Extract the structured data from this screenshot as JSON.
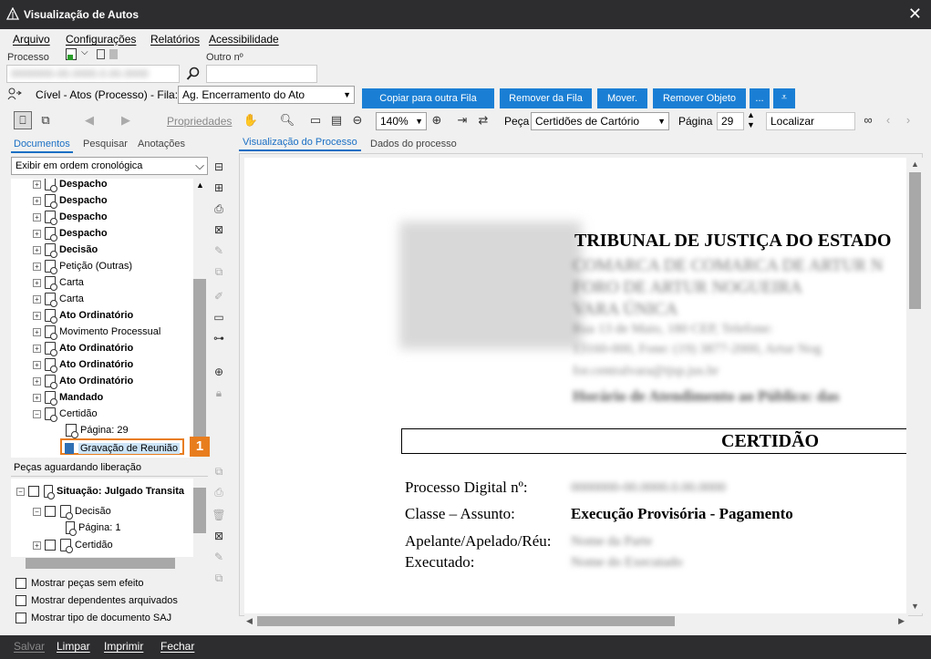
{
  "window": {
    "title": "Visualização de Autos",
    "close": "✕"
  },
  "menu": {
    "file": "Arquivo",
    "settings": "Configurações",
    "reports": "Relatórios",
    "accessibility": "Acessibilidade"
  },
  "process_bar": {
    "process_label": "Processo",
    "other_label": "Outro nº",
    "process_value": "0000000-00.0000.0.00.0000"
  },
  "queue_bar": {
    "queue_label": "Cível - Atos (Processo) - Fila:",
    "queue_value": "Ag. Encerramento do Ato",
    "copy_btn": "Copiar para outra Fila",
    "remove_btn": "Remover da Fila",
    "move_btn": "Mover.",
    "remove_obj_btn": "Remover Objeto",
    "more_btn": "..."
  },
  "toolbar": {
    "properties": "Propriedades",
    "zoom": "140%",
    "piece_label": "Peça",
    "piece_value": "Certidões de Cartório",
    "page_label": "Página",
    "page_value": "29",
    "find_placeholder": "Localizar"
  },
  "left_tabs": {
    "documents": "Documentos",
    "search": "Pesquisar",
    "notes": "Anotações"
  },
  "order_select": "Exibir em ordem cronológica",
  "tree": [
    {
      "label": "Despacho",
      "bold": true
    },
    {
      "label": "Despacho",
      "bold": true
    },
    {
      "label": "Despacho",
      "bold": true
    },
    {
      "label": "Despacho",
      "bold": true
    },
    {
      "label": "Decisão",
      "bold": true
    },
    {
      "label": "Petição (Outras)",
      "bold": false
    },
    {
      "label": "Carta",
      "bold": false
    },
    {
      "label": "Carta",
      "bold": false
    },
    {
      "label": "Ato Ordinatório",
      "bold": true
    },
    {
      "label": "Movimento Processual",
      "bold": false
    },
    {
      "label": "Ato Ordinatório",
      "bold": true
    },
    {
      "label": "Ato Ordinatório",
      "bold": true
    },
    {
      "label": "Ato Ordinatório",
      "bold": true
    },
    {
      "label": "Mandado",
      "bold": true
    },
    {
      "label": "Certidão",
      "bold": false
    }
  ],
  "tree_child_page": "Página: 29",
  "tree_selected": "Gravação de Reunião",
  "callout": "1",
  "pending": {
    "title": "Peças aguardando liberação",
    "situation": "Situação: Julgado Transita",
    "decision": "Decisão",
    "page": "Página: 1",
    "certidao": "Certidão"
  },
  "checks": {
    "no_effect": "Mostrar peças sem efeito",
    "archived": "Mostrar dependentes arquivados",
    "doc_type": "Mostrar tipo de documento SAJ"
  },
  "view_tabs": {
    "view": "Visualização do Processo",
    "data": "Dados do processo"
  },
  "document": {
    "court": "TRIBUNAL DE JUSTIÇA DO ESTADO",
    "blur1": "COMARCA DE COMARCA DE ARTUR N",
    "blur2": "FORO DE ARTUR NOGUEIRA",
    "blur3": "VARA ÚNICA",
    "blur4": "Rua 13 de Maio, 180 CEP, Telefone:",
    "blur5": "13160-000, Fone: (19) 3877-2000, Artur Nog",
    "blur6": "for.centralvara@tjsp.jus.br",
    "blur7": "Horário de Atendimento ao Público: das",
    "heading": "CERTIDÃO",
    "proc_label": "Processo Digital nº:",
    "proc_value": "0000000-00.0000.0.00.0000",
    "class_label": "Classe – Assunto:",
    "class_value": "Execução Provisória - Pagamento",
    "parties_label": "Apelante/Apelado/Réu:",
    "parties_value": "Nome da Parte",
    "exec_label": "Executado:",
    "exec_value": "Nome do Executado"
  },
  "bottom": {
    "save": "Salvar",
    "clear": "Limpar",
    "print": "Imprimir",
    "close": "Fechar"
  }
}
